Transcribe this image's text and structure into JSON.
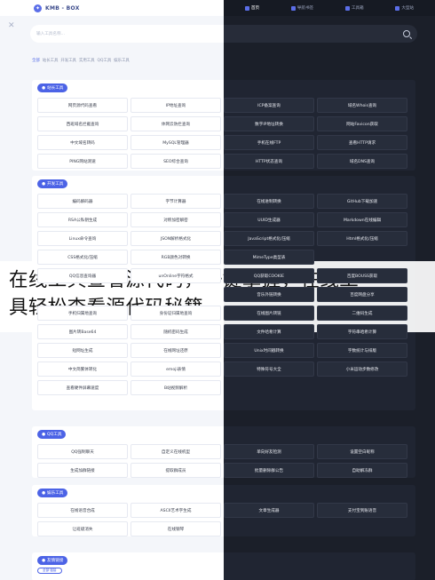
{
  "header": {
    "logo_text": "KMB - BOX",
    "nav": [
      "首页",
      "导航书签",
      "工具箱",
      "大型站"
    ]
  },
  "search": {
    "placeholder": "输入工具名称..."
  },
  "breadcrumb": [
    "全部",
    "站长工具",
    "开发工具",
    "实用工具",
    "QQ工具",
    "娱乐工具"
  ],
  "sections": [
    {
      "title": "站长工具",
      "rows": [
        [
          "网页源代码查看",
          "IP地址查询",
          "ICP备案查询",
          "域名Whois查询"
        ],
        [
          "西班域名拦截查询",
          "体网云防拦查询",
          "数字IP地址转换",
          "网站Favicon获取"
        ],
        [
          "中文域名转码",
          "MySQL管理器",
          "手机在线FTP",
          "查看HTTP请求"
        ],
        [
          "PING网站测速",
          "SEO综合查询",
          "HTTP状态查询",
          "域名DNS查询"
        ]
      ]
    },
    {
      "title": "开发工具",
      "rows": [
        [
          "编码解码器",
          "字节计算器",
          "在线进制转换",
          "GitHub下载加速"
        ],
        [
          "RSA公私钥生成",
          "对称加密解密",
          "UUID生成器",
          "Markdown在线编辑"
        ],
        [
          "Linux命令查询",
          "JSON解析格式化",
          "JavaScript格式化/压缩",
          "Html格式化/压缩"
        ],
        [
          "CSS格式化/压缩",
          "RGB颜色对转换",
          "MimeType类型表",
          ""
        ],
        [
          "QQ信息查询器",
          "unOnline字符格式",
          "QQ获取COOKIE",
          "百度BOUSS获取"
        ],
        [
          "",
          "",
          "音乐外链转换",
          "百度网盘分享"
        ],
        [
          "手机归属地查询",
          "身份证归属地查询",
          "在线图片转链",
          "二维码生成"
        ],
        [
          "图片转Base64",
          "随机密码生成",
          "文件哈希计算",
          "字符串哈希计算"
        ],
        [
          "短网址生成",
          "在线网址还原",
          "Unix时间戳转换",
          "字数统计与排版"
        ],
        [
          "中文简繁体转化",
          "emoji表情",
          "特殊符号大全",
          "小米运动步数修改"
        ],
        [
          "查看硬件屏幕速度",
          "B站视频解析",
          "",
          ""
        ]
      ]
    },
    {
      "title": "QQ工具",
      "rows": [
        [
          "QQ强制聊天",
          "自定义在线机型",
          "单向好友检测",
          "设置空白昵称"
        ],
        [
          "生成加群链接",
          "提取群成员",
          "批量删除群公告",
          "自助解冻群"
        ]
      ]
    },
    {
      "title": "娱乐工具",
      "rows": [
        [
          "在线语音合成",
          "ASCII艺术字生成",
          "文章生成器",
          "支付宝到账语音"
        ],
        [
          "让班级消失",
          "在线钢琴",
          "",
          ""
        ]
      ]
    },
    {
      "title": "友情链接",
      "sub": "全部·链接"
    }
  ],
  "overlay": {
    "line1": "在线工具查看源代码，一键掌握，在线工",
    "line2": "具轻松查看源代码秘籍"
  }
}
